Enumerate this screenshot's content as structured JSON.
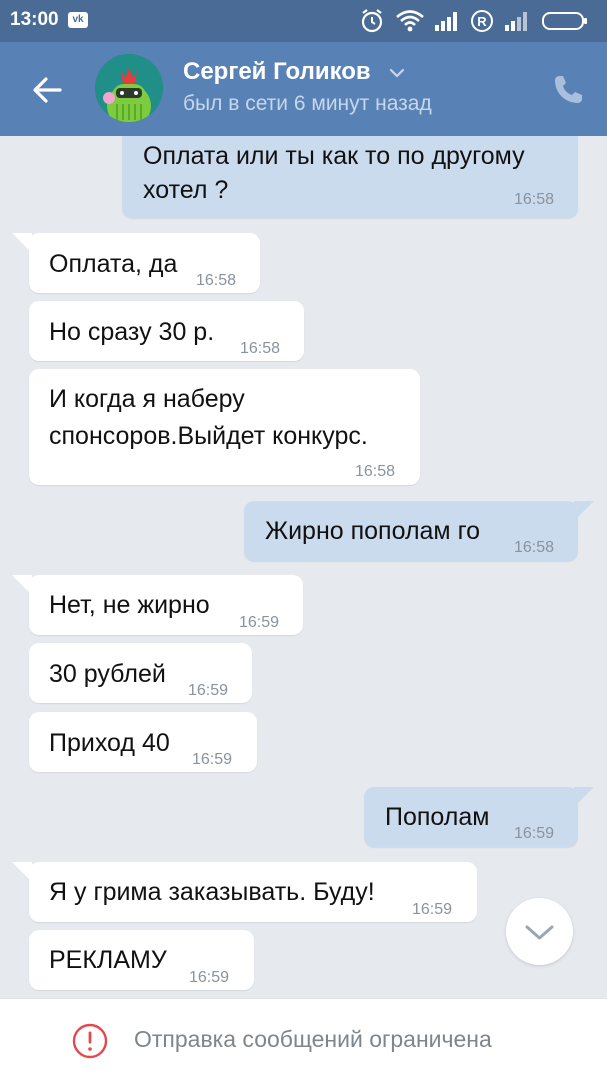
{
  "status_bar": {
    "time": "13:00",
    "app_badge": "vk",
    "icons": [
      "alarm-icon",
      "wifi-icon",
      "signal-icon",
      "roaming-r-icon",
      "signal-icon",
      "battery-icon"
    ]
  },
  "header": {
    "contact_name": "Сергей Голиков",
    "last_seen": "был в сети 6 минут назад",
    "accent_color": "#5881b6"
  },
  "messages": [
    {
      "direction": "out",
      "lines": [
        "Оплата или ты как то по другому",
        "хотел ?"
      ],
      "time": "16:58"
    },
    {
      "direction": "in",
      "lines": [
        "Оплата, да"
      ],
      "time": "16:58"
    },
    {
      "direction": "in",
      "lines": [
        "Но сразу 30 р."
      ],
      "time": "16:58"
    },
    {
      "direction": "in",
      "lines": [
        "И когда я наберу",
        "спонсоров.Выйдет конкурс."
      ],
      "time": "16:58"
    },
    {
      "direction": "out",
      "lines": [
        "Жирно пополам го"
      ],
      "time": "16:58"
    },
    {
      "direction": "in",
      "lines": [
        "Нет, не жирно"
      ],
      "time": "16:59"
    },
    {
      "direction": "in",
      "lines": [
        "30 рублей"
      ],
      "time": "16:59"
    },
    {
      "direction": "in",
      "lines": [
        "Приход 40"
      ],
      "time": "16:59"
    },
    {
      "direction": "out",
      "lines": [
        "Пополам"
      ],
      "time": "16:59"
    },
    {
      "direction": "in",
      "lines": [
        "Я у грима заказывать. Буду!"
      ],
      "time": "16:59"
    },
    {
      "direction": "in",
      "lines": [
        "РЕКЛАМУ"
      ],
      "time": "16:59"
    }
  ],
  "footer": {
    "notice": "Отправка сообщений ограничена"
  }
}
